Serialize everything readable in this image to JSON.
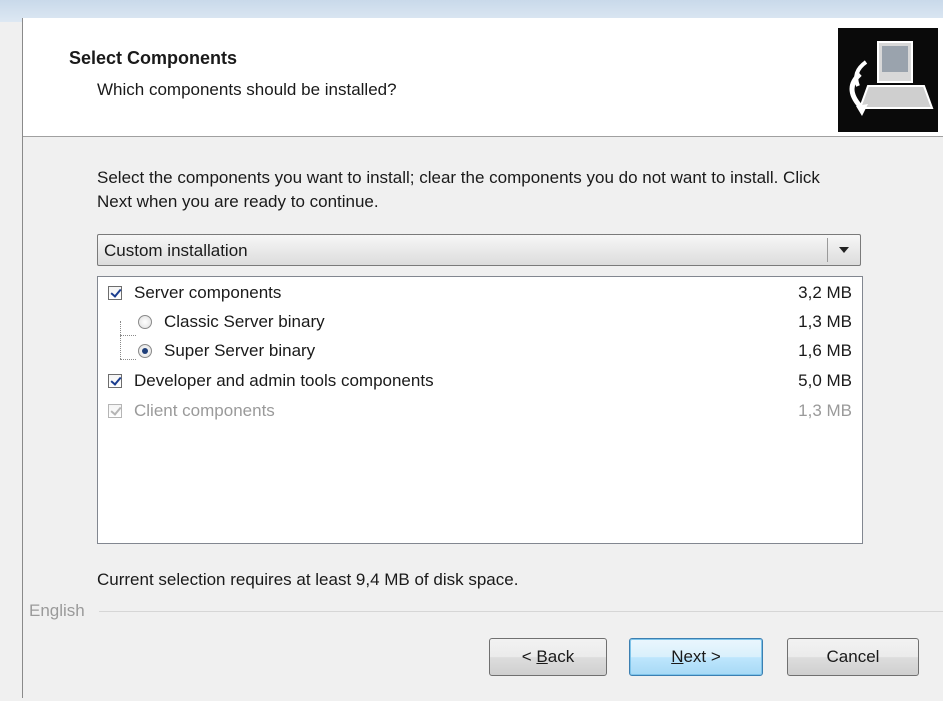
{
  "header": {
    "title": "Select Components",
    "subtitle": "Which components should be installed?",
    "icon": "installer-computer-icon"
  },
  "intro": "Select the components you want to install; clear the components you do not want to install. Click Next when you are ready to continue.",
  "install_type": {
    "selected": "Custom installation"
  },
  "components": [
    {
      "label": "Server components",
      "size": "3,2 MB",
      "control": "checkbox",
      "checked": true,
      "enabled": true
    },
    {
      "label": "Classic Server binary",
      "size": "1,3 MB",
      "control": "radio",
      "checked": false,
      "enabled": true
    },
    {
      "label": "Super Server binary",
      "size": "1,6 MB",
      "control": "radio",
      "checked": true,
      "enabled": true
    },
    {
      "label": "Developer and admin tools components",
      "size": "5,0 MB",
      "control": "checkbox",
      "checked": true,
      "enabled": true
    },
    {
      "label": "Client components",
      "size": "1,3 MB",
      "control": "checkbox",
      "checked": true,
      "enabled": false
    }
  ],
  "disk_space": "Current selection requires at least 9,4 MB of disk space.",
  "language": "English",
  "buttons": {
    "back_prefix": "< ",
    "back_underlined": "B",
    "back_rest": "ack",
    "next_underlined": "N",
    "next_rest": "ext >",
    "cancel": "Cancel"
  },
  "colors": {
    "header_bg": "#ffffff",
    "window_bg": "#f0f0f0",
    "default_button": "#bee6fd",
    "disabled_text": "#9a9a9a"
  }
}
